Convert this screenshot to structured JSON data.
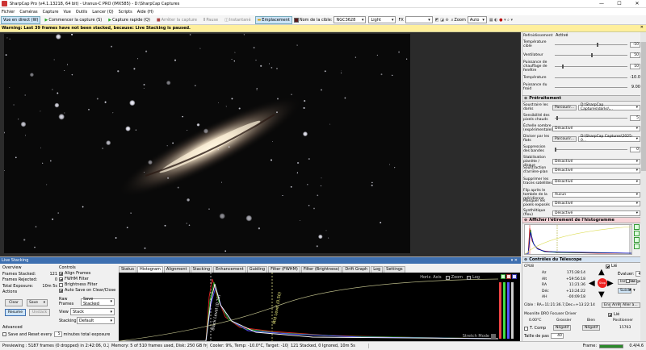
{
  "window": {
    "title": "SharpCap Pro (v4.1.13218, 64 bit) - Uranus-C PRO (IMX585) - D:\\SharpCap Captures",
    "minimize": "—",
    "maximize": "☐",
    "close": "✕"
  },
  "menu": [
    "Fichier",
    "Caméras",
    "Capture",
    "Vue",
    "Outils",
    "Lancer (Q)",
    "Scripts",
    "Aide (H)"
  ],
  "toolbar": {
    "live": "Vue en direct (W)",
    "start": "Commencer la capture (S)",
    "quick": "Capture rapide (Q)",
    "stop": "Arrêter la capture",
    "pause": "Pause",
    "snapshot": "Instantané",
    "location": "Emplacement",
    "target_label": "Nom de la cible:",
    "target": "NGC3628",
    "theme": "Light",
    "fx_label": "FX",
    "zoom_label": "Zoom",
    "zoom": "Auto"
  },
  "warning": {
    "text": "Warning: Last 39 frames have not been stacked, because: Live Stacking is paused.",
    "close": "✕"
  },
  "camera_controls": {
    "rows": [
      {
        "label": "Refroidissement",
        "value": "Activé"
      },
      {
        "label": "Température cible",
        "value": "-10"
      },
      {
        "label": "Ventilateur",
        "value": "50"
      },
      {
        "label": "Puissance de chauffage de fenêtre",
        "value": "10"
      },
      {
        "label": "Température",
        "value": "-10.0"
      },
      {
        "label": "Puissance du froid",
        "value": "9.00"
      }
    ]
  },
  "pretraitement": {
    "title": "Prétraitement",
    "rows": [
      {
        "label": "Soustraire les darks",
        "button": "Parcourir...",
        "value": "D:\\SharpCap Captures\\darks\\..."
      },
      {
        "label": "Sensibilité des pixels chauds",
        "value": "5"
      },
      {
        "label": "Échelle sombre (expérimentale)",
        "value": "Désactivé"
      },
      {
        "label": "Diviser par les flats",
        "button": "Parcourir...",
        "value": "D:\\SharpCap Captures\\2025-0..."
      },
      {
        "label": "Suppression des bandes",
        "value": "0"
      },
      {
        "label": "Stabilisation planète / disque",
        "value": "Désactivé"
      },
      {
        "label": "Soustraction d'arrière-plan",
        "value": "Désactivé"
      },
      {
        "label": "Supprimer les traces satellites",
        "value": "Désactivé"
      },
      {
        "label": "Flip après le tombée de la méridienne",
        "value": "Aucun"
      },
      {
        "label": "Masquer les pixels exposés",
        "value": "Désactivé"
      },
      {
        "label": "Synthétique (flou)",
        "value": "Désactivé"
      }
    ]
  },
  "histogram_panel": {
    "title": "Afficher l'étirement de l'histogramme"
  },
  "telescope": {
    "title": "Contrôles du Télescope",
    "gpu": "CPU8",
    "az_label": "Az",
    "az": "175:28:14",
    "alt_label": "Alt",
    "alt": "+59:56:18",
    "ra_label": "RA",
    "ra": "11:21:36",
    "dec_label": "Déc",
    "dec": "+13:24:22",
    "ah_label": "AH",
    "ah": "-00:09:18",
    "speed_label": "Évaluer:",
    "speed": "4x",
    "install": "Installer",
    "park": "Garer",
    "stop": "Stop",
    "slew": "Suivi",
    "goto": "Aller à...",
    "target_line": "Cible : RA=11:21:36.7,Dec=+13:22:14",
    "send": "Envo",
    "focuser": "Moonlite DRO Focuser Driver",
    "temp": "0.00°C",
    "coarse": "Grossier",
    "fine": "Bien",
    "position_label": "Positionner",
    "position": "15763",
    "tcomp": "T. Comp",
    "neg": "Négatif",
    "pos": "Négatif",
    "step_label": "Taille de pas",
    "step": "40",
    "reset": "Arrêt",
    "lit": "Lié",
    "lit2": "Lié",
    "no_park": "ne garer"
  },
  "live_stacking": {
    "title": "Live Stacking",
    "overview": "Overview",
    "frames_stacked_label": "Frames Stacked:",
    "frames_stacked": "121",
    "frames_rejected_label": "Frames Rejected:",
    "frames_rejected": "0",
    "total_exposure_label": "Total Exposure:",
    "total_exposure": "10m 5s",
    "actions": "Actions",
    "clear": "Clear",
    "save": "Save",
    "resume": "Resume",
    "unstack": "Unstack",
    "advanced": "Advanced",
    "save_reset": "Save and Reset every",
    "save_reset_val": "5",
    "save_reset_unit": "minutes total exposure",
    "controls": "Controls",
    "align": "Align Frames",
    "fwhm": "FWHM Filter",
    "brightness": "Brightness Filter",
    "autosave": "Auto Save on Clear/Close",
    "raw_label": "Raw Frames",
    "raw": "Save Stacked",
    "view_label": "View",
    "view": "Stack",
    "stacking_label": "Stacking",
    "stacking": "Default",
    "tabs": [
      "Status",
      "Histogram",
      "Alignment",
      "Stacking",
      "Enhancement",
      "Guiding",
      "Filter (FWHM)",
      "Filter (Brightness)",
      "Drift Graph",
      "Log",
      "Settings"
    ],
    "histo_opts": {
      "horiz": "Horiz. Axis",
      "zoom": "Zoom",
      "log": "Log"
    },
    "stretch": "Stretch Mode",
    "black_label": "Black Level (0.25)",
    "white_label": "Mid Level (0.50)"
  },
  "status": {
    "preview": "Previewing : 5187 frames (0 dropped) in 2:42:06, 0.2 fps",
    "memory": "Memory: 5 of 510 frames used, Disk: 250 GB free",
    "cooler": "Cooler: 9%, Temp: -10.0°C, Target: -10.0°C",
    "stack": "121 Stacked, 0 Ignored, 10m 5s",
    "frame_label": "Frame:",
    "frame": "0.4/4.6"
  },
  "colors": {
    "accent": "#3d6fb0",
    "warning": "#ffef9c",
    "sky": "#090909"
  },
  "icons": [
    "app-icon",
    "play-icon",
    "record-icon",
    "pause-icon",
    "camera-icon",
    "color-swatch-icon",
    "zoom-icon",
    "settings-icon",
    "arrow-up-icon",
    "arrow-down-icon",
    "arrow-left-icon",
    "arrow-right-icon",
    "stop-icon"
  ]
}
